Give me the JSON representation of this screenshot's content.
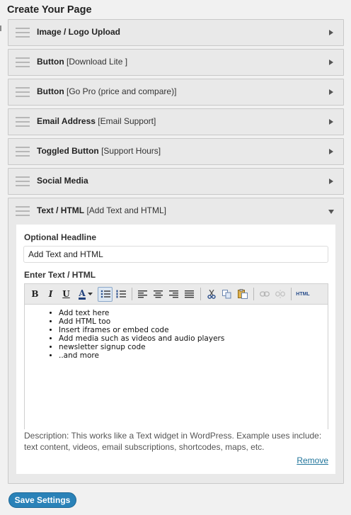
{
  "page": {
    "title": "Create Your Page"
  },
  "panels": [
    {
      "title": "Image / Logo Upload",
      "subtitle": ""
    },
    {
      "title": "Button",
      "subtitle": "[Download Lite ]"
    },
    {
      "title": "Button",
      "subtitle": "[Go Pro (price and compare)]"
    },
    {
      "title": "Email Address",
      "subtitle": "[Email Support]"
    },
    {
      "title": "Toggled Button",
      "subtitle": "[Support Hours]"
    },
    {
      "title": "Social Media",
      "subtitle": ""
    }
  ],
  "open_panel": {
    "title": "Text / HTML",
    "subtitle": "[Add Text and HTML]",
    "headline_label": "Optional Headline",
    "headline_value": "Add Text and HTML",
    "text_label": "Enter Text / HTML",
    "toolbar": {
      "bold": "B",
      "italic": "I",
      "underline": "U",
      "color": "A",
      "html": "HTML"
    },
    "content_items": [
      "Add text here",
      "Add HTML too",
      "Insert iframes or embed code",
      "Add media such as videos and audio players",
      "newsletter signup code",
      "..and more"
    ],
    "description": "Description: This works like a Text widget in WordPress. Example uses include: text content, videos, email subscriptions, shortcodes, maps, etc.",
    "remove_label": "Remove"
  },
  "save_button": "Save Settings"
}
